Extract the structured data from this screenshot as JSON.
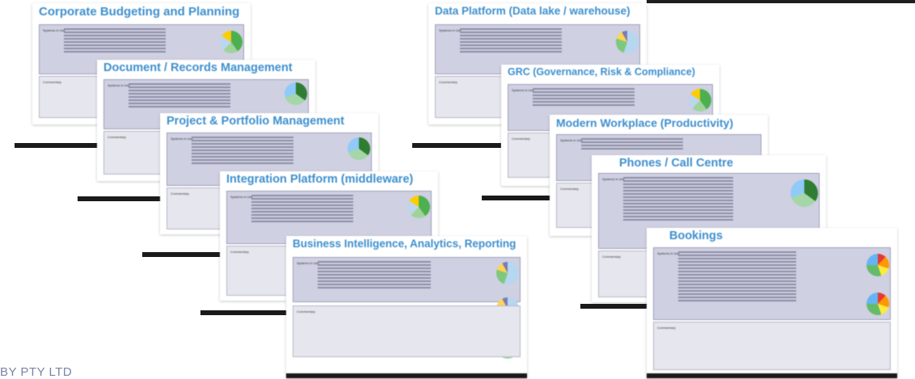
{
  "slides": {
    "corporate_budgeting": "Corporate Budgeting and Planning",
    "data_platform": "Data Platform (Data lake / warehouse)",
    "document_records": "Document / Records Management",
    "grc": "GRC (Governance, Risk & Compliance)",
    "project_portfolio": "Project & Portfolio Management",
    "modern_workplace": "Modern Workplace (Productivity)",
    "integration_platform": "Integration Platform (middleware)",
    "phones_call_centre": "Phones / Call Centre",
    "business_intelligence": "Business Intelligence, Analytics, Reporting",
    "bookings": "Bookings"
  },
  "labels": {
    "systems_in_use": "Systems in Use",
    "commentary": "Commentary"
  },
  "footer": {
    "company": "BY PTY LTD"
  }
}
